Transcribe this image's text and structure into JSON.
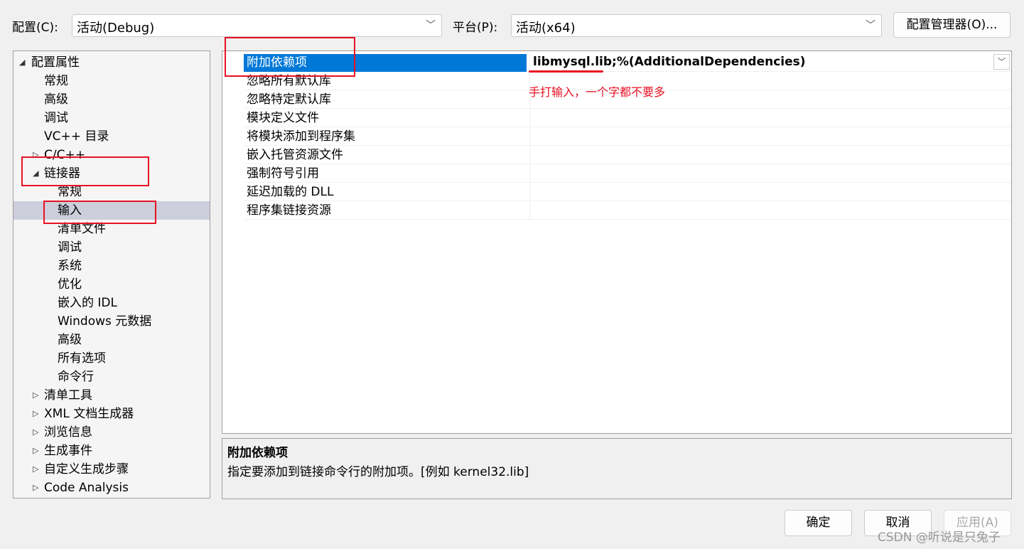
{
  "header": {
    "config_label": "配置(C):",
    "config_value": "活动(Debug)",
    "platform_label": "平台(P):",
    "platform_value": "活动(x64)",
    "config_manager": "配置管理器(O)..."
  },
  "tree": [
    {
      "label": "配置属性",
      "level": 0,
      "arrow": "expanded"
    },
    {
      "label": "常规",
      "level": 1
    },
    {
      "label": "高级",
      "level": 1
    },
    {
      "label": "调试",
      "level": 1
    },
    {
      "label": "VC++ 目录",
      "level": 1
    },
    {
      "label": "C/C++",
      "level": 1,
      "arrow": "collapsed"
    },
    {
      "label": "链接器",
      "level": 1,
      "arrow": "expanded"
    },
    {
      "label": "常规",
      "level": 2
    },
    {
      "label": "输入",
      "level": 2,
      "selected": true
    },
    {
      "label": "清单文件",
      "level": 2
    },
    {
      "label": "调试",
      "level": 2
    },
    {
      "label": "系统",
      "level": 2
    },
    {
      "label": "优化",
      "level": 2
    },
    {
      "label": "嵌入的 IDL",
      "level": 2
    },
    {
      "label": "Windows 元数据",
      "level": 2
    },
    {
      "label": "高级",
      "level": 2
    },
    {
      "label": "所有选项",
      "level": 2
    },
    {
      "label": "命令行",
      "level": 2
    },
    {
      "label": "清单工具",
      "level": 1,
      "arrow": "collapsed"
    },
    {
      "label": "XML 文档生成器",
      "level": 1,
      "arrow": "collapsed"
    },
    {
      "label": "浏览信息",
      "level": 1,
      "arrow": "collapsed"
    },
    {
      "label": "生成事件",
      "level": 1,
      "arrow": "collapsed"
    },
    {
      "label": "自定义生成步骤",
      "level": 1,
      "arrow": "collapsed"
    },
    {
      "label": "Code Analysis",
      "level": 1,
      "arrow": "collapsed"
    }
  ],
  "properties": [
    {
      "name": "附加依赖项",
      "value": "libmysql.lib;%(AdditionalDependencies)",
      "selected": true
    },
    {
      "name": "忽略所有默认库",
      "value": ""
    },
    {
      "name": "忽略特定默认库",
      "value": ""
    },
    {
      "name": "模块定义文件",
      "value": ""
    },
    {
      "name": "将模块添加到程序集",
      "value": ""
    },
    {
      "name": "嵌入托管资源文件",
      "value": ""
    },
    {
      "name": "强制符号引用",
      "value": ""
    },
    {
      "name": "延迟加载的 DLL",
      "value": ""
    },
    {
      "name": "程序集链接资源",
      "value": ""
    }
  ],
  "annotation": "手打输入，一个字都不要多",
  "description": {
    "title": "附加依赖项",
    "text": "指定要添加到链接命令行的附加项。[例如 kernel32.lib]"
  },
  "buttons": {
    "ok": "确定",
    "cancel": "取消",
    "apply": "应用(A)"
  },
  "watermark": "CSDN @听说是只兔子",
  "colors": {
    "selection": "#0078d7",
    "annotation": "#e81123"
  }
}
